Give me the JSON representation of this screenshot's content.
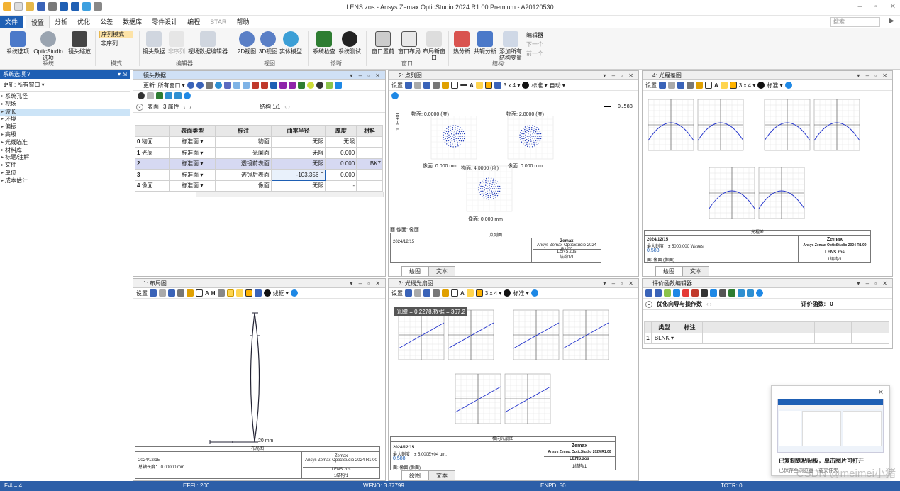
{
  "app": {
    "title": "LENS.zos - Ansys Zemax OpticStudio 2024 R1.00   Premium - A20120530"
  },
  "menu": [
    "文件",
    "设置",
    "分析",
    "优化",
    "公差",
    "数据库",
    "零件设计",
    "编程",
    "STAR",
    "帮助"
  ],
  "search": {
    "placeholder": "搜索..."
  },
  "ribbon": {
    "buttons": [
      "系统选项",
      "OpticStudio 选项",
      "镜头缩放",
      "序列模式",
      "非序列",
      "镜头数据",
      "非序列",
      "视场数据编辑器",
      "2D视图",
      "3D视图",
      "实体模型",
      "系统检查",
      "系统测试",
      "窗口置前",
      "窗口布局",
      "布局新窗口",
      "热分析",
      "共轭分析",
      "添加所有结构变量",
      "编辑器",
      "下一个",
      "前一个"
    ],
    "groups": [
      "系统",
      "模式",
      "编辑器",
      "视图",
      "诊断",
      "窗口",
      "结构:"
    ]
  },
  "left_panel": {
    "title": "系统选项 ?",
    "update": "更新: 所有窗口 ▾",
    "items": [
      "系统孔径",
      "视场",
      "波长",
      "环境",
      "偏振",
      "高级",
      "光线瞄准",
      "材料库",
      "标题/注解",
      "文件",
      "单位",
      "成本估计"
    ],
    "selected": "波长"
  },
  "lens_data": {
    "title": "镜头数据",
    "update": "更新: 所有窗口 ▾",
    "surface_label": "表面",
    "props_label": "3 属性",
    "config_label": "结构 1/1",
    "headers": [
      "",
      "表面类型",
      "标注",
      "曲率半径",
      "厚度",
      "材料"
    ],
    "rows": [
      {
        "n": "0",
        "name": "物面",
        "type": "标准面 ▾",
        "comment": "物面",
        "radius": "无限",
        "thickness": "无限",
        "material": ""
      },
      {
        "n": "1",
        "name": "光阑",
        "type": "标准面 ▾",
        "comment": "光阑面",
        "radius": "无限",
        "thickness": "0.000",
        "material": ""
      },
      {
        "n": "2",
        "name": "",
        "type": "标准面 ▾",
        "comment": "透镜前表面",
        "radius": "无限",
        "thickness": "0.000",
        "material": "BK7"
      },
      {
        "n": "3",
        "name": "",
        "type": "标准面 ▾",
        "comment": "透镜后表面",
        "radius": "-103.356",
        "flag": "F",
        "thickness": "0.000",
        "material": ""
      },
      {
        "n": "4",
        "name": "像面",
        "type": "标准面 ▾",
        "comment": "像面",
        "radius": "无限",
        "thickness": "-",
        "material": ""
      }
    ]
  },
  "spot": {
    "title": "2: 点列图",
    "toolbar": {
      "settings": "设置",
      "grid": "3 x 4 ▾",
      "std": "标准 ▾",
      "auto": "自动 ▾"
    },
    "scale": "0.588",
    "axis": "1.0E+01",
    "fields": [
      "物面: 0.0000 (度)",
      "物面: 2.8000 (度)",
      "物面: 4.0000 (度)"
    ],
    "image_labels": [
      "像面: 0.000 mm",
      "像面: 0.000 mm",
      "像面: 0.000 mm"
    ],
    "surface": "面 像面: 像面",
    "caption": "点列图",
    "date": "2024/12/15",
    "company": "Zemax",
    "product": "Ansys Zemax OpticStudio 2024 R1.00",
    "file": "LENS.zos",
    "config": "结构1/1",
    "tabs": [
      "绘图",
      "文本"
    ]
  },
  "ray_fan": {
    "title": "4: 光程差图",
    "toolbar": {
      "settings": "设置",
      "grid": "3 x 4 ▾",
      "std": "标准 ▾"
    },
    "caption": "光程差",
    "date": "2024/12/15",
    "info": "最大刻度：± 5000.000 Waves.",
    "val": "0.588",
    "surface": "面: 像面 (像面)",
    "company": "Zemax",
    "product": "Ansys Zemax OpticStudio 2024 R1.00",
    "file": "LENS.zos",
    "config": "1结构/1",
    "tabs": [
      "绘图",
      "文本"
    ]
  },
  "layout": {
    "title": "1: 布局图",
    "toolbar": {
      "settings": "设置",
      "style": "线框 ▾"
    },
    "scale_label": "20 mm",
    "caption": "布局图",
    "date": "2024/12/15",
    "info": "总轴长度：    0.00000 mm",
    "company": "Zemax",
    "product": "Ansys Zemax OpticStudio 2024 R1.00",
    "file": "LENS.zos",
    "config": "1结构/1"
  },
  "ray_aberration": {
    "title": "3: 光线光扇图",
    "toolbar": {
      "settings": "设置",
      "grid": "3 x 4 ▾",
      "std": "标准 ▾"
    },
    "tooltip": "光瞳 = 0.2278,数据 = 367.2",
    "caption": "横向光扇图",
    "date": "2024/12/15",
    "info": "最大刻度：± 5.000E+04 μm.",
    "val": "0.588",
    "surface": "面: 像面 (像面)",
    "company": "Zemax",
    "product": "Ansys Zemax OpticStudio 2024 R1.00",
    "file": "LENS.zos",
    "config": "1结构/1",
    "tabs": [
      "绘图",
      "文本"
    ]
  },
  "merit": {
    "title": "评价函数编辑器",
    "wizard": "优化向导与操作数",
    "value_label": "评价函数:",
    "value": "0",
    "headers": [
      "类型",
      "标注"
    ],
    "row": {
      "n": "1",
      "type": "BLNK ▾"
    }
  },
  "popup": {
    "line1": "已复制到粘贴板，单击图片可打开",
    "line2": "已保存至浏览器下载文件夹"
  },
  "status": {
    "fn": "F/# = 4",
    "effl": "EFFL: 200",
    "wfno": "WFNO: 3.87799",
    "enpd": "ENPD: 50",
    "totr": "TOTR: 0"
  },
  "watermark": "CSDN @meimei小猪"
}
